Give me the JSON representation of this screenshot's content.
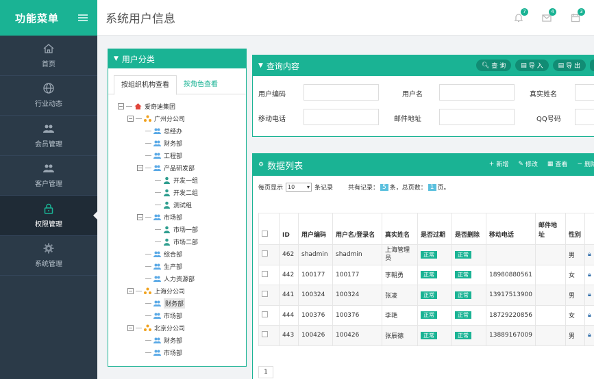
{
  "sidebar": {
    "title": "功能菜单",
    "items": [
      {
        "label": "首页",
        "icon": "home-icon"
      },
      {
        "label": "行业动态",
        "icon": "globe-icon"
      },
      {
        "label": "会员管理",
        "icon": "users-icon"
      },
      {
        "label": "客户管理",
        "icon": "users-icon"
      },
      {
        "label": "权限管理",
        "icon": "lock-icon",
        "active": true
      },
      {
        "label": "系统管理",
        "icon": "gear-icon"
      }
    ]
  },
  "header": {
    "title": "系统用户信息",
    "badges": {
      "bell": "7",
      "mail": "4",
      "calendar": "3"
    }
  },
  "tree_panel": {
    "title": "用户分类",
    "tabs": [
      "按组织机构查看",
      "按角色查看"
    ],
    "nodes": {
      "root": "爱奇迪集团",
      "gz": "广州分公司",
      "gz_zjb": "总经办",
      "gz_cwb": "财务部",
      "gz_gcb": "工程部",
      "gz_cpyfb": "产品研发部",
      "dev1": "开发一组",
      "dev2": "开发二组",
      "test": "测试组",
      "gz_scb": "市场部",
      "sc1": "市场一部",
      "sc2": "市场二部",
      "gz_zhb": "综合部",
      "gz_scb2": "生产部",
      "gz_rlzyb": "人力资源部",
      "sh": "上海分公司",
      "sh_cwb": "财务部",
      "sh_scb": "市场部",
      "bj": "北京分公司",
      "bj_cwb": "财务部",
      "bj_scb": "市场部"
    }
  },
  "query": {
    "title": "查询内容",
    "buttons": {
      "search": "查 询",
      "import": "导 入",
      "export": "导 出"
    },
    "labels": {
      "user_code": "用户编码",
      "username": "用户名",
      "real_name": "真实姓名",
      "mobile": "移动电话",
      "email": "邮件地址",
      "qq": "QQ号码"
    }
  },
  "datalist": {
    "title": "数据列表",
    "actions": {
      "add": "新增",
      "edit": "修改",
      "view": "查看",
      "delete": "删除"
    },
    "per_page_prefix": "每页显示",
    "per_page_value": "10",
    "per_page_suffix": "条记录",
    "total_prefix": "共有记录：",
    "total_records": "5",
    "total_mid": "条，总页数：",
    "total_pages": "1",
    "total_suffix": "页。",
    "columns": [
      "ID",
      "用户编码",
      "用户名/登录名",
      "真实姓名",
      "是否过期",
      "是否删除",
      "移动电话",
      "邮件地址",
      "性别"
    ],
    "rows": [
      {
        "id": "462",
        "code": "shadmin",
        "username": "shadmin",
        "name": "上海管理员",
        "expired": "正常",
        "deleted": "正常",
        "mobile": "",
        "email": "",
        "gender": "男"
      },
      {
        "id": "442",
        "code": "100177",
        "username": "100177",
        "name": "李朝勇",
        "expired": "正常",
        "deleted": "正常",
        "mobile": "18980880561",
        "email": "",
        "gender": "女"
      },
      {
        "id": "441",
        "code": "100324",
        "username": "100324",
        "name": "张凌",
        "expired": "正常",
        "deleted": "正常",
        "mobile": "13917513900",
        "email": "",
        "gender": "男"
      },
      {
        "id": "444",
        "code": "100376",
        "username": "100376",
        "name": "李艳",
        "expired": "正常",
        "deleted": "正常",
        "mobile": "18729220856",
        "email": "",
        "gender": "女"
      },
      {
        "id": "443",
        "code": "100426",
        "username": "100426",
        "name": "张辰德",
        "expired": "正常",
        "deleted": "正常",
        "mobile": "13889167009",
        "email": "",
        "gender": "男"
      }
    ],
    "page": "1"
  }
}
